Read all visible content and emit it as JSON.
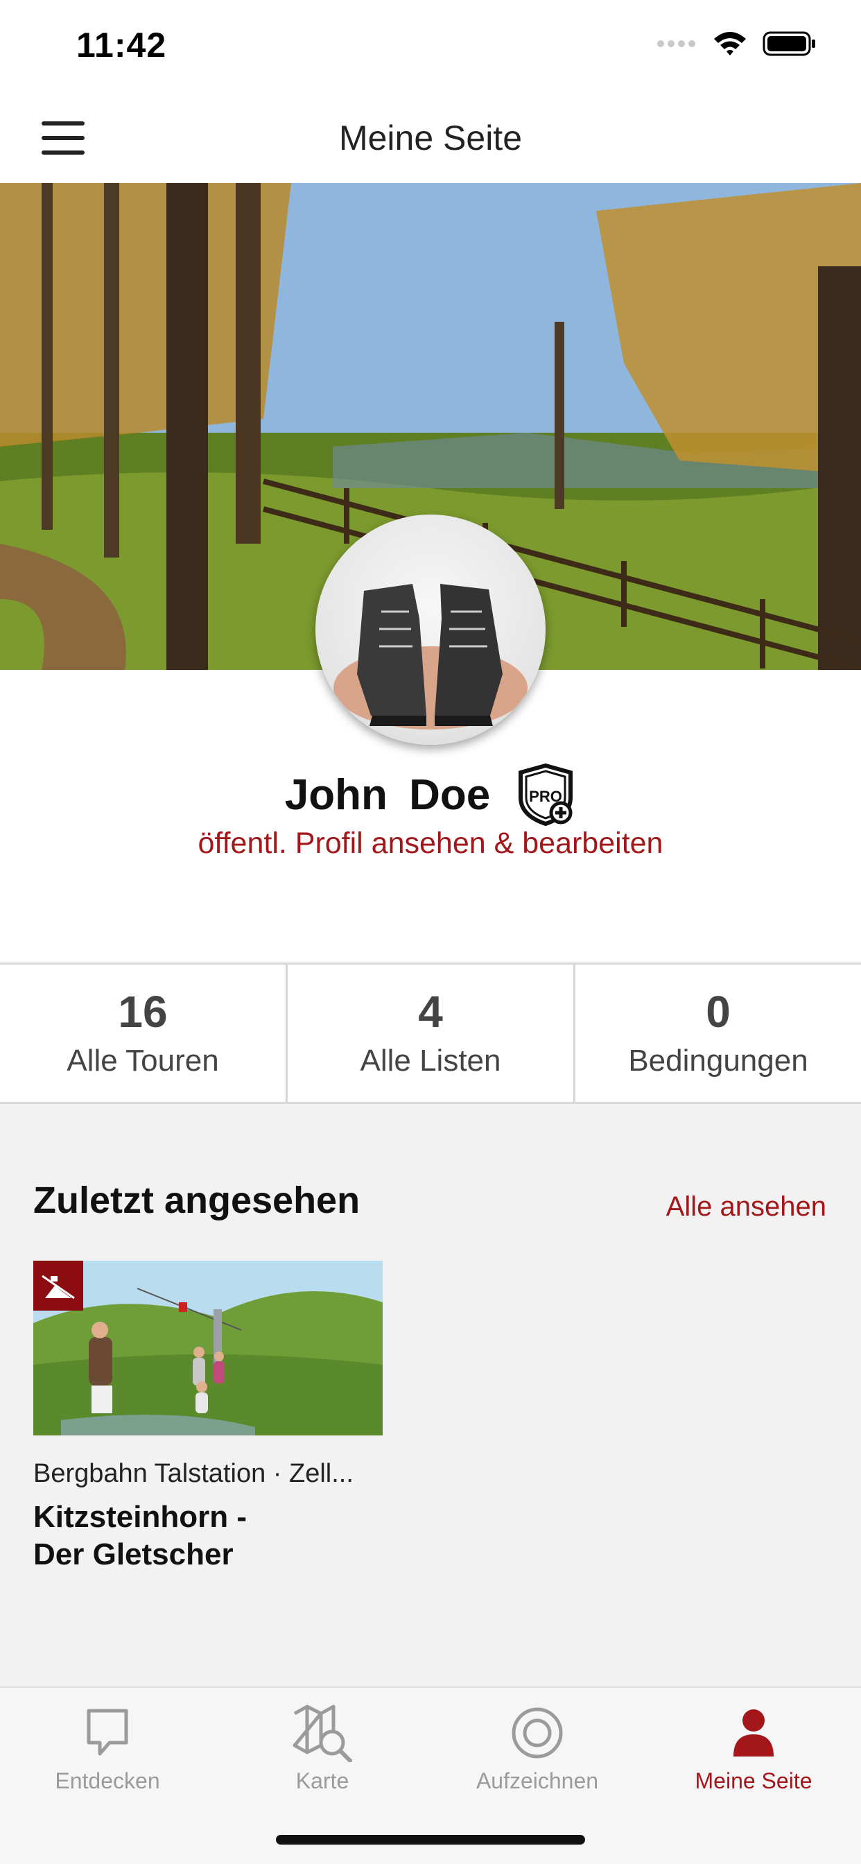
{
  "status_bar": {
    "time": "11:42"
  },
  "header": {
    "title": "Meine Seite"
  },
  "profile": {
    "first_name": "John",
    "last_name": "Doe",
    "badge": "PRO",
    "link_text": "öffentl. Profil ansehen & bearbeiten"
  },
  "stats": [
    {
      "value": "16",
      "label": "Alle Touren"
    },
    {
      "value": "4",
      "label": "Alle Listen"
    },
    {
      "value": "0",
      "label": "Bedingungen"
    }
  ],
  "recent": {
    "title": "Zuletzt angesehen",
    "see_all": "Alle ansehen",
    "items": [
      {
        "location": "Bergbahn Talstation · Zell...",
        "title_line1": "Kitzsteinhorn -",
        "title_line2": "Der Gletscher"
      }
    ]
  },
  "tabs": [
    {
      "label": "Entdecken",
      "icon": "discover-icon"
    },
    {
      "label": "Karte",
      "icon": "map-search-icon"
    },
    {
      "label": "Aufzeichnen",
      "icon": "record-icon"
    },
    {
      "label": "Meine Seite",
      "icon": "person-icon"
    }
  ],
  "colors": {
    "accent": "#a31619",
    "badge": "#8b0d12",
    "inactive": "#9b9b9b"
  }
}
